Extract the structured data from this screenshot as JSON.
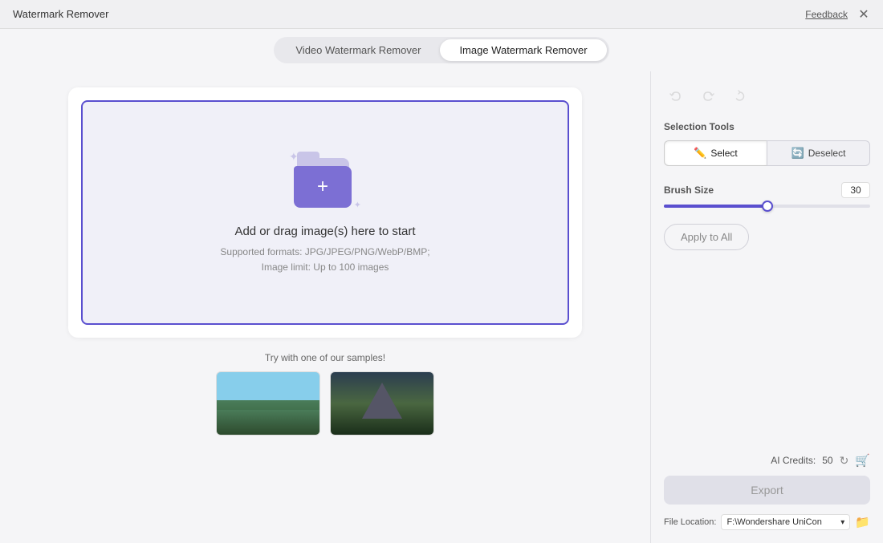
{
  "app": {
    "title": "Watermark Remover",
    "feedback_label": "Feedback"
  },
  "tabs": [
    {
      "id": "video",
      "label": "Video Watermark Remover",
      "active": false
    },
    {
      "id": "image",
      "label": "Image Watermark Remover",
      "active": true
    }
  ],
  "dropzone": {
    "title": "Add or drag image(s) here to start",
    "subtitle_line1": "Supported formats: JPG/JPEG/PNG/WebP/BMP;",
    "subtitle_line2": "Image limit: Up to 100 images"
  },
  "samples": {
    "label": "Try with one of our samples!"
  },
  "tools": {
    "undo_title": "Undo",
    "redo_title": "Redo",
    "rotate_title": "Rotate",
    "section_label": "Selection Tools",
    "select_btn": "Select",
    "deselect_btn": "Deselect",
    "brush_size_label": "Brush Size",
    "brush_size_value": "30",
    "apply_all_label": "Apply to All"
  },
  "export": {
    "ai_credits_label": "AI Credits:",
    "ai_credits_value": "50",
    "export_label": "Export",
    "file_location_label": "File Location:",
    "file_location_path": "F:\\Wondershare UniCon"
  }
}
